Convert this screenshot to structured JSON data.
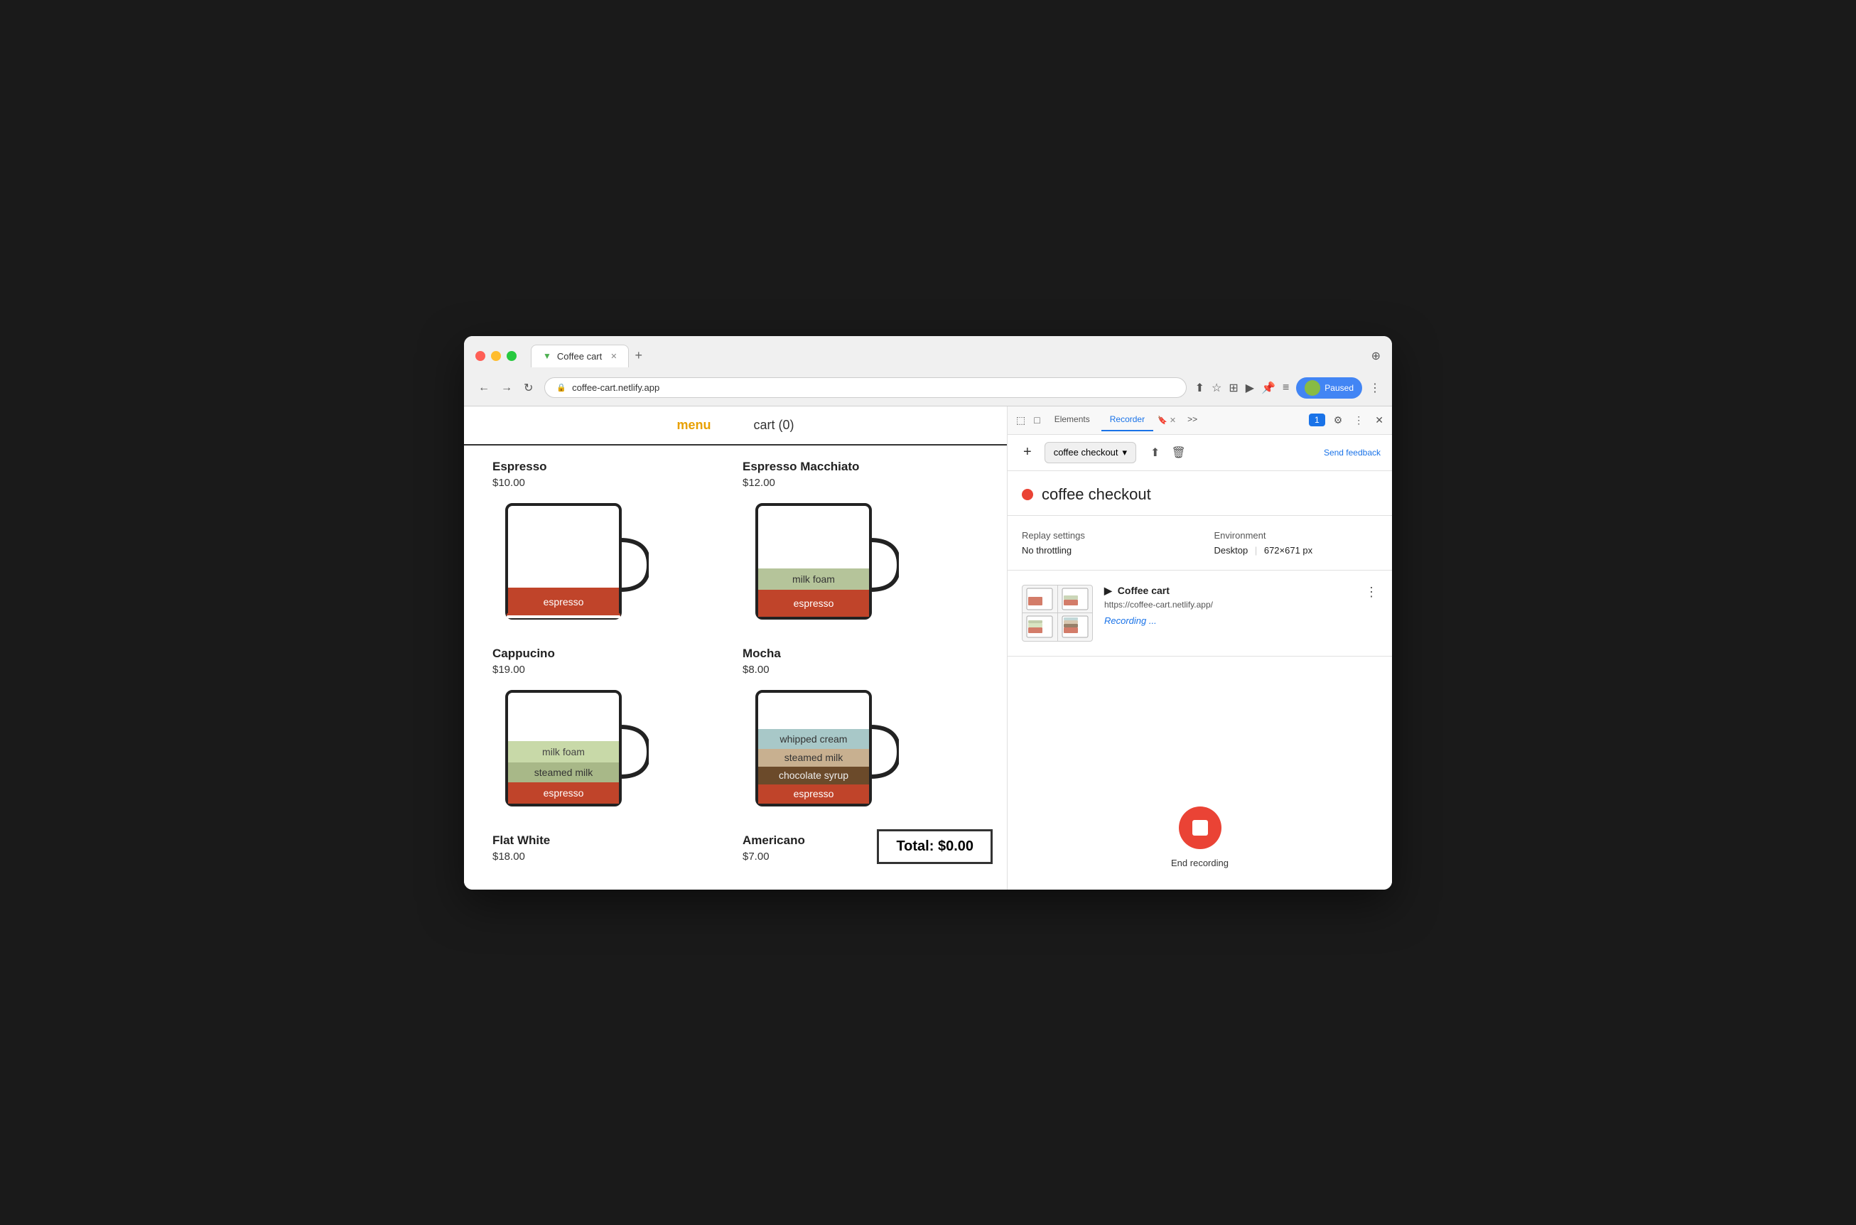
{
  "browser": {
    "tab_title": "Coffee cart",
    "tab_favicon": "▼",
    "url": "coffee-cart.netlify.app",
    "paused_label": "Paused"
  },
  "app": {
    "nav": {
      "menu_label": "menu",
      "cart_label": "cart (0)"
    },
    "total_label": "Total: $0.00",
    "coffees": [
      {
        "name": "Espresso",
        "price": "$10.00",
        "layers": [
          {
            "label": "espresso",
            "color": "#c0442a",
            "height": 35
          }
        ]
      },
      {
        "name": "Espresso Macchiato",
        "price": "$12.00",
        "layers": [
          {
            "label": "milk foam",
            "color": "#b5c49a",
            "height": 25
          },
          {
            "label": "espresso",
            "color": "#c0442a",
            "height": 35
          }
        ]
      },
      {
        "name": "Cappucino",
        "price": "$19.00",
        "layers": [
          {
            "label": "milk foam",
            "color": "#c8d9a8",
            "height": 30
          },
          {
            "label": "steamed milk",
            "color": "#a8b888",
            "height": 28
          },
          {
            "label": "espresso",
            "color": "#c0442a",
            "height": 30
          }
        ]
      },
      {
        "name": "Mocha",
        "price": "$8.00",
        "layers": [
          {
            "label": "whipped cream",
            "color": "#a8c8c8",
            "height": 28
          },
          {
            "label": "steamed milk",
            "color": "#c8b090",
            "height": 25
          },
          {
            "label": "chocolate syrup",
            "color": "#6b4a2a",
            "height": 25
          },
          {
            "label": "espresso",
            "color": "#c0442a",
            "height": 28
          }
        ]
      },
      {
        "name": "Flat White",
        "price": "$18.00",
        "layers": []
      },
      {
        "name": "Americano",
        "price": "$7.00",
        "layers": []
      }
    ]
  },
  "devtools": {
    "tabs": [
      "Elements",
      "Recorder",
      "more"
    ],
    "active_tab": "Recorder",
    "chat_badge": "1",
    "recorder_name": "coffee checkout",
    "recording_dot_color": "#ea4335",
    "recording_title": "coffee checkout",
    "replay_settings_label": "Replay settings",
    "no_throttling": "No throttling",
    "environment_label": "Environment",
    "environment_value": "Desktop",
    "dimensions": "672×671 px",
    "preview_title": "Coffee cart",
    "preview_url": "https://coffee-cart.netlify.app/",
    "recording_status": "Recording ...",
    "send_feedback_label": "Send feedback",
    "end_recording_label": "End recording"
  }
}
